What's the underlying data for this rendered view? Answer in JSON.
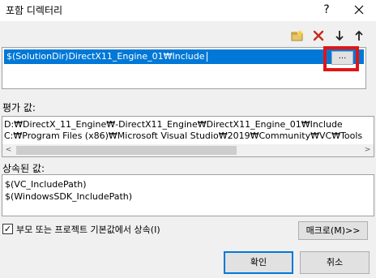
{
  "window": {
    "title": "포함 디렉터리",
    "help_glyph": "?",
    "close_glyph": "✕"
  },
  "toolbar": {
    "new_line_icon": "folder-new-icon",
    "delete_icon": "delete-icon",
    "move_down_icon": "arrow-down-icon",
    "move_up_icon": "arrow-up-icon",
    "delete_color": "#c42b1c"
  },
  "editor": {
    "selected_value": "$(SolutionDir)DirectX11_Engine_01₩Include",
    "browse_label": "...",
    "highlight_color": "#e11515",
    "selection_color": "#0078d7"
  },
  "evaluated": {
    "label": "평가 값:",
    "lines": [
      "D:₩DirectX_11_Engine₩-DirectX11_Engine₩DirectX11_Engine_01₩Include",
      "C:₩Program Files (x86)₩Microsoft Visual Studio₩2019₩Community₩VC₩Tools"
    ],
    "scroll_left": "<",
    "scroll_right": ">"
  },
  "inherited": {
    "label": "상속된 값:",
    "lines": [
      "$(VC_IncludePath)",
      "$(WindowsSDK_IncludePath)"
    ]
  },
  "inherit_checkbox": {
    "checked": true,
    "check_glyph": "✓",
    "label": "부모 또는 프로젝트 기본값에서 상속(I)"
  },
  "buttons": {
    "macro": "매크로(M)>>",
    "ok": "확인",
    "cancel": "취소"
  }
}
